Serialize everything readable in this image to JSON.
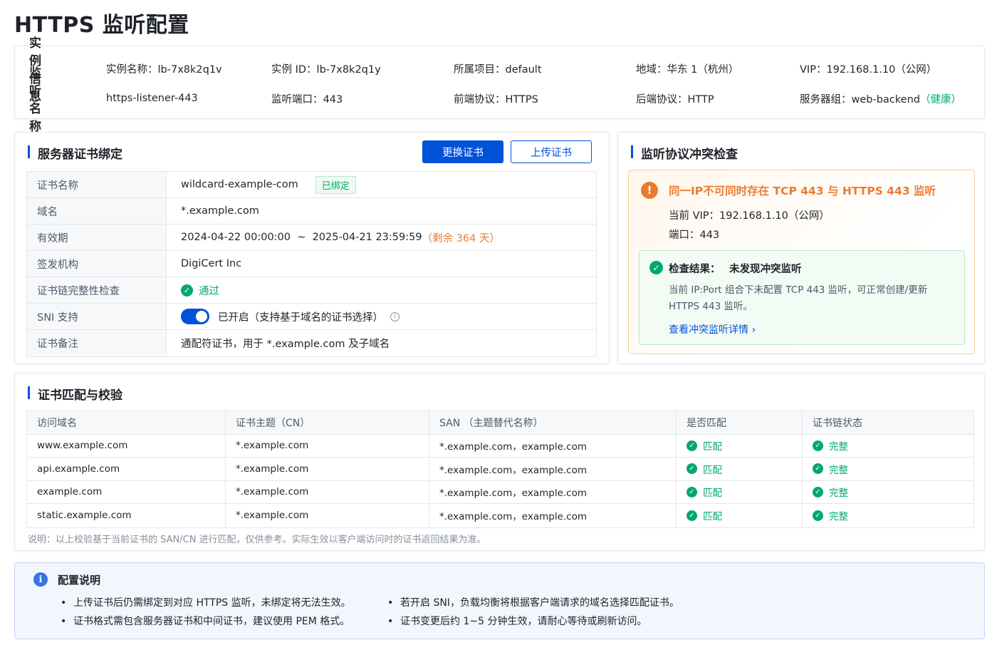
{
  "page": {
    "title": "HTTPS 监听配置"
  },
  "instance": {
    "head1": "实例信息",
    "head2": "监听名称",
    "name": "实例名称：lb-7x8k2q1v",
    "id": "实例 ID：lb-7x8k2q1y",
    "project": "所属项目：default",
    "region": "地域：华东 1（杭州）",
    "vip": "VIP：192.168.1.10（公网）",
    "listener_name": "https-listener-443",
    "port": "监听端口：443",
    "frontend": "前端协议：HTTPS",
    "backend": "后端协议：HTTP",
    "server_group": "服务器组：web-backend",
    "health": "（健康）"
  },
  "cert": {
    "title": "服务器证书绑定",
    "replace_btn": "更换证书",
    "upload_btn": "上传证书",
    "rows": [
      {
        "key": "证书名称",
        "value": "wildcard-example-com",
        "tag": "已绑定"
      },
      {
        "key": "域名",
        "value": "*.example.com"
      },
      {
        "key": "有效期",
        "value": "2024-04-22 00:00:00  ~  2025-04-21 23:59:59",
        "extra": "（剩余 364 天）"
      },
      {
        "key": "签发机构",
        "value": "DigiCert Inc"
      },
      {
        "key": "证书链完整性检查",
        "value": "通过"
      },
      {
        "key": "SNI 支持",
        "value": "已开启（支持基于域名的证书选择）"
      },
      {
        "key": "证书备注",
        "value": "通配符证书，用于 *.example.com 及子域名"
      }
    ]
  },
  "conflict": {
    "title": "监听协议冲突检查",
    "warn_title": "同一IP不可同时存在 TCP 443 与 HTTPS 443 监听",
    "vip_line": "当前 VIP：192.168.1.10（公网）",
    "port_line": "端口：443",
    "check_label": "检查结果：",
    "check_result": "未发现冲突监听",
    "check_desc": "当前 IP:Port 组合下未配置 TCP 443 监听，可正常创建/更新 HTTPS 443 监听。",
    "link": "查看冲突监听详情 ›"
  },
  "match": {
    "title": "证书匹配与校验",
    "headers": [
      "访问域名",
      "证书主题（CN）",
      "SAN （主题替代名称）",
      "是否匹配",
      "证书链状态"
    ],
    "rows": [
      [
        "www.example.com",
        "*.example.com",
        "*.example.com，example.com",
        "匹配",
        "完整"
      ],
      [
        "api.example.com",
        "*.example.com",
        "*.example.com，example.com",
        "匹配",
        "完整"
      ],
      [
        "example.com",
        "*.example.com",
        "*.example.com，example.com",
        "匹配",
        "完整"
      ],
      [
        "static.example.com",
        "*.example.com",
        "*.example.com，example.com",
        "匹配",
        "完整"
      ]
    ],
    "note": "说明：以上校验基于当前证书的 SAN/CN 进行匹配，仅供参考。实际生效以客户端访问时的证书返回结果为准。"
  },
  "help": {
    "title": "配置说明",
    "left": [
      "上传证书后仍需绑定到对应 HTTPS 监听，未绑定将无法生效。",
      "证书格式需包含服务器证书和中间证书，建议使用 PEM 格式。"
    ],
    "right": [
      "若开启 SNI，负载均衡将根据客户端请求的域名选择匹配证书。",
      "证书变更后约 1~5 分钟生效，请耐心等待或刷新访问。"
    ]
  },
  "colors": {
    "primary": "#0052d9",
    "success": "#00a870",
    "warning": "#ed7b2f"
  }
}
